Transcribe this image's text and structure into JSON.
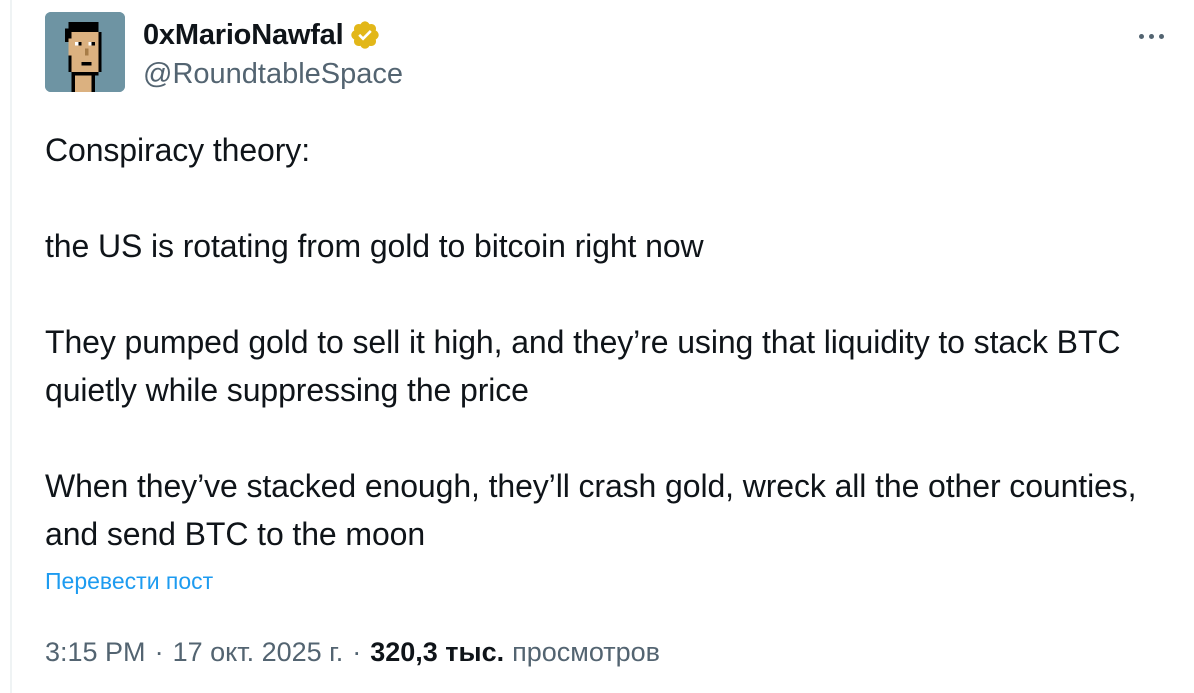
{
  "author": {
    "display_name": "0xMarioNawfal",
    "handle": "@RoundtableSpace",
    "verified_color": "#e2b719",
    "avatar_icon": "pixel-punk-avatar"
  },
  "tweet": {
    "paragraphs": [
      "Conspiracy theory:",
      "the US is rotating from gold to bitcoin right now",
      "They pumped gold to sell it high, and they’re using that liquidity to stack BTC quietly while suppressing the price",
      "When they’ve stacked enough, they’ll crash gold, wreck all the other counties, and send BTC to the moon"
    ],
    "translate_label": "Перевести пост"
  },
  "meta": {
    "time": "3:15 PM",
    "separator": "·",
    "date": "17 окт. 2025 г.",
    "views_count": "320,3 тыс.",
    "views_label": "просмотров"
  },
  "colors": {
    "link": "#1d9bf0",
    "secondary_text": "#536471",
    "primary_text": "#0f1419"
  }
}
